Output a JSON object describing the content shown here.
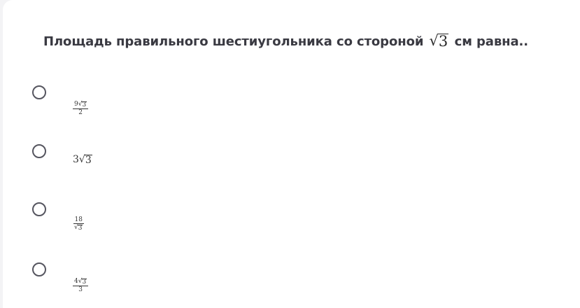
{
  "question": {
    "text_before": "Площадь правильного шестиугольника со стороной",
    "math": "3",
    "text_after": "см  равна.."
  },
  "options": [
    {
      "type": "fraction",
      "numerator_coef": "9",
      "numerator_radicand": "3",
      "denominator": "2"
    },
    {
      "type": "inline",
      "coef": "3",
      "radicand": "3"
    },
    {
      "type": "fraction_sqrt_den",
      "numerator": "18",
      "denominator_radicand": "3"
    },
    {
      "type": "fraction",
      "numerator_coef": "4",
      "numerator_radicand": "3",
      "denominator": "3"
    }
  ]
}
